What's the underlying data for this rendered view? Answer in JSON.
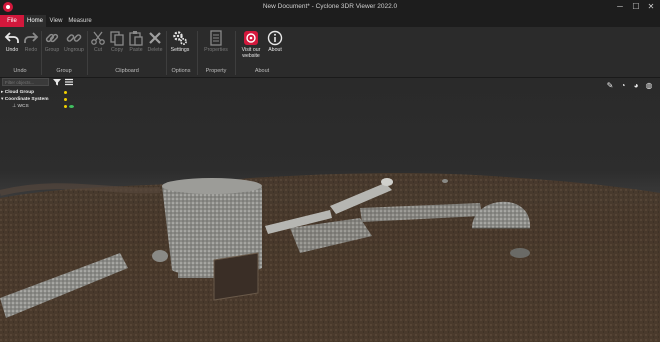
{
  "window": {
    "title": "New Document* - Cyclone 3DR Viewer 2022.0",
    "buttons": {
      "minimize": "─",
      "maximize": "☐",
      "close": "✕"
    }
  },
  "tabs": [
    {
      "label": "File"
    },
    {
      "label": "Home"
    },
    {
      "label": "View"
    },
    {
      "label": "Measure"
    }
  ],
  "ribbon": {
    "buttons": {
      "undo": "Undo",
      "redo": "Redo",
      "group": "Group",
      "ungroup": "Ungroup",
      "cut": "Cut",
      "copy": "Copy",
      "paste": "Paste",
      "delete": "Delete",
      "settings": "Settings",
      "properties": "Properties",
      "visit_line1": "Visit our",
      "visit_line2": "website",
      "about": "About"
    },
    "groups": {
      "undo": "Undo",
      "group": "Group",
      "clipboard": "Clipboard",
      "options": "Options",
      "property": "Property",
      "about": "About"
    }
  },
  "panel": {
    "filter_placeholder": "Filter objects...",
    "tree": [
      {
        "label": "Cloud Group"
      },
      {
        "label": "Coordinate System"
      },
      {
        "label": "WCS"
      }
    ]
  },
  "colors": {
    "accent": "#d3183c",
    "ribbon_bg": "#2b2b2b",
    "titlebar_bg": "#1d1d1d"
  }
}
